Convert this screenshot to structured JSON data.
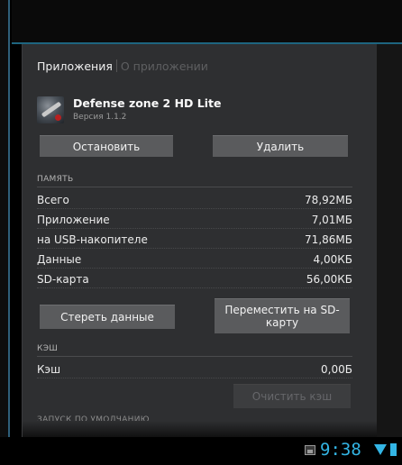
{
  "tabs": {
    "active": "Приложения",
    "inactive": "О приложении"
  },
  "app": {
    "name": "Defense zone 2 HD Lite",
    "version": "Версия 1.1.2",
    "icon": "game-icon"
  },
  "buttons": {
    "stop": "Остановить",
    "uninstall": "Удалить",
    "clear_data": "Стереть данные",
    "move_sd": "Переместить на SD-карту",
    "clear_cache": "Очистить кэш"
  },
  "storage": {
    "header": "ПАМЯТЬ",
    "rows": [
      {
        "label": "Всего",
        "value": "78,92МБ"
      },
      {
        "label": "Приложение",
        "value": "7,01МБ"
      },
      {
        "label": "на USB-накопителе",
        "value": "71,86МБ"
      },
      {
        "label": "Данные",
        "value": "4,00КБ"
      },
      {
        "label": "SD-карта",
        "value": "56,00КБ"
      }
    ]
  },
  "cache": {
    "header": "КЭШ",
    "label": "Кэш",
    "value": "0,00Б"
  },
  "launch_default": {
    "header": "ЗАПУСК ПО УМОЛЧАНИЮ"
  },
  "status_bar": {
    "time": "9:38",
    "accent": "#33b5e5"
  }
}
